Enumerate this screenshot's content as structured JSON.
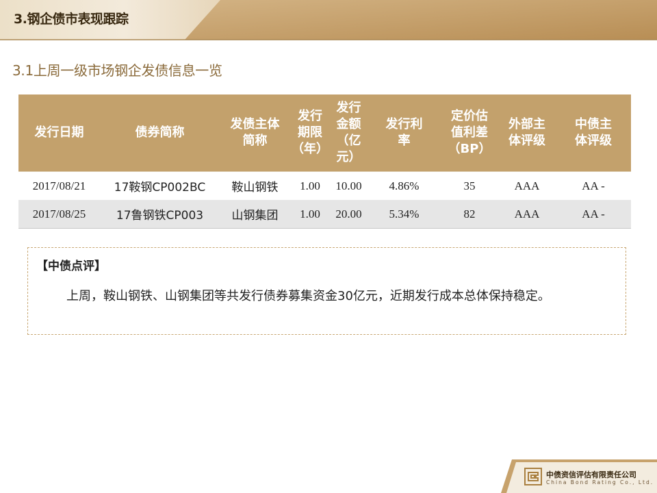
{
  "header": {
    "title": "3.钢企债市表现跟踪"
  },
  "subtitle": "3.1上周一级市场钢企发债信息一览",
  "table": {
    "columns": [
      "发行日期",
      "债券简称",
      "发债主体\n简称",
      "发行\n期限\n（年）",
      "发行\n金额\n（亿\n元）",
      "发行利\n率",
      "定价估\n值利差\n（BP）",
      "外部主\n体评级",
      "中债主\n体评级"
    ],
    "rows": [
      [
        "2017/08/21",
        "17鞍钢CP002BC",
        "鞍山钢铁",
        "1.00",
        "10.00",
        "4.86%",
        "35",
        "AAA",
        "AA -"
      ],
      [
        "2017/08/25",
        "17鲁钢铁CP003",
        "山钢集团",
        "1.00",
        "20.00",
        "5.34%",
        "82",
        "AAA",
        "AA -"
      ]
    ]
  },
  "comment": {
    "title": "【中债点评】",
    "body": "上周，鞍山钢铁、山钢集团等共发行债券募集资金30亿元，近期发行成本总体保持稳定。"
  },
  "footer": {
    "company_name": "中债资信评估有限责任公司",
    "company_name_en": "China Bond Rating Co., Ltd."
  },
  "colors": {
    "accent_gold": "#c3a16c",
    "header_band_light": "#efe3cf",
    "header_band_dark": "#c7a26c",
    "row_alt": "#e6e6e6",
    "text_dark": "#3a2a12",
    "subtitle_color": "#8a6a3a"
  }
}
